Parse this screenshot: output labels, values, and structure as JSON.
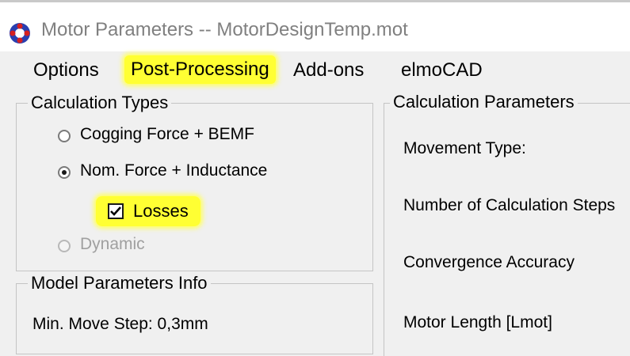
{
  "window": {
    "title": "Motor Parameters -- MotorDesignTemp.mot",
    "icon": "app-logo-icon"
  },
  "menu": {
    "items": [
      {
        "label": "Options",
        "highlighted": false
      },
      {
        "label": "Post-Processing",
        "highlighted": true
      },
      {
        "label": "Add-ons",
        "highlighted": false
      },
      {
        "label": "elmoCAD",
        "highlighted": false
      }
    ]
  },
  "calculation_types": {
    "group_label": "Calculation Types",
    "options": [
      {
        "label": "Cogging Force + BEMF",
        "selected": false,
        "enabled": true
      },
      {
        "label": "Nom. Force + Inductance",
        "selected": true,
        "enabled": true
      },
      {
        "label": "Dynamic",
        "selected": false,
        "enabled": false
      }
    ],
    "losses": {
      "label": "Losses",
      "checked": true,
      "highlighted": true
    }
  },
  "model_parameters_info": {
    "group_label": "Model Parameters Info",
    "min_move_step": "Min. Move Step: 0,3mm"
  },
  "calculation_parameters": {
    "group_label": "Calculation Parameters",
    "labels": [
      "Movement Type:",
      "Number of Calculation Steps",
      "Convergence Accuracy",
      "Motor Length [Lmot]"
    ]
  },
  "colors": {
    "highlight": "#ffff33",
    "title_text": "#808080",
    "disabled_text": "#a0a0a0"
  }
}
